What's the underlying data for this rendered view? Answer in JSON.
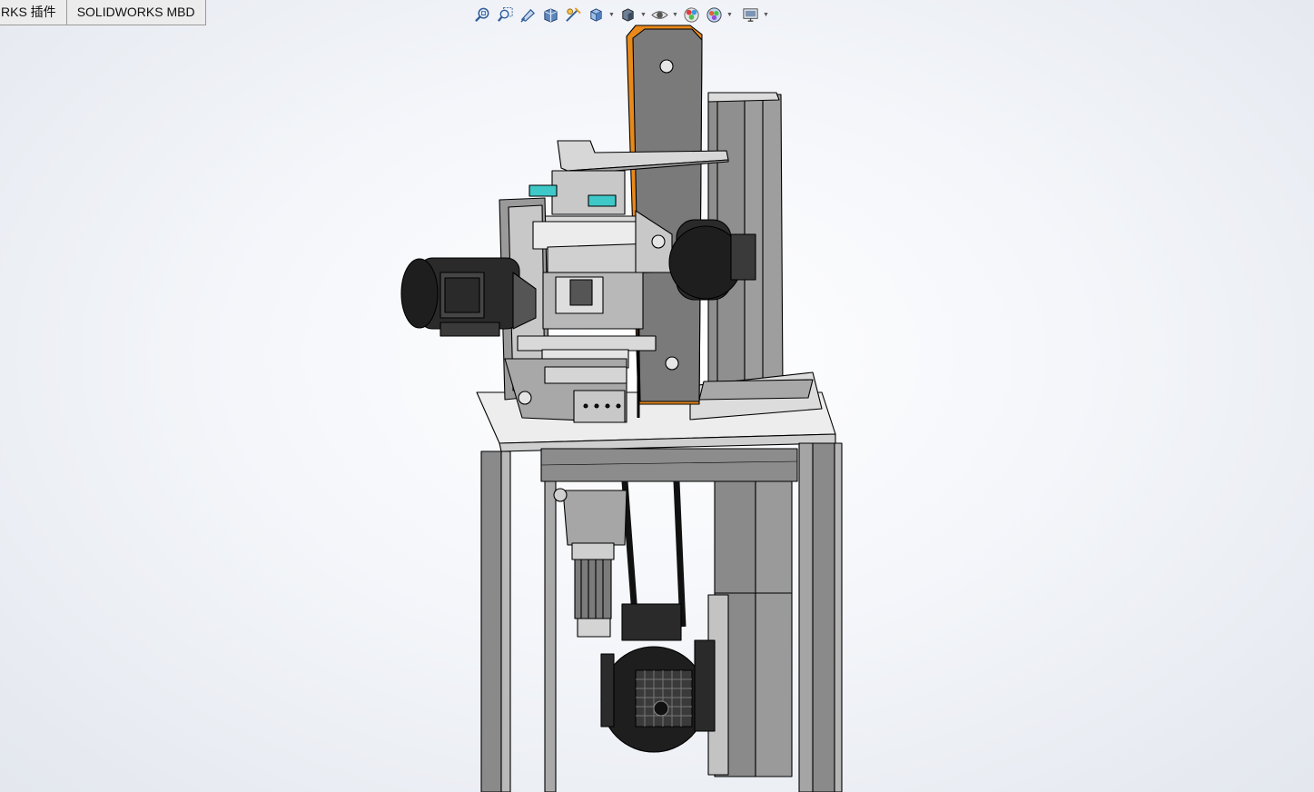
{
  "tabs": [
    {
      "label": "RKS 插件"
    },
    {
      "label": "SOLIDWORKS MBD"
    }
  ],
  "heads_up_toolbar": [
    {
      "icon": "zoom-to-fit-icon"
    },
    {
      "icon": "zoom-to-area-icon"
    },
    {
      "icon": "previous-view-icon"
    },
    {
      "icon": "section-view-icon"
    },
    {
      "icon": "dynamic-annotation-icon"
    },
    {
      "icon": "view-orientation-icon",
      "dropdown": true
    },
    {
      "icon": "display-style-icon",
      "dropdown": true
    },
    {
      "icon": "hide-show-items-icon",
      "dropdown": true
    },
    {
      "icon": "edit-appearance-icon"
    },
    {
      "icon": "apply-scene-icon",
      "dropdown": true
    },
    {
      "icon": "view-settings-icon",
      "dropdown": true
    }
  ],
  "colors": {
    "part_gray": "#7a7a7a",
    "part_light": "#cfcfcf",
    "motor_black": "#1e1e1e",
    "belt_orange": "#e8891c",
    "accent_cyan": "#3fc8c8",
    "table_top": "#ececec"
  }
}
